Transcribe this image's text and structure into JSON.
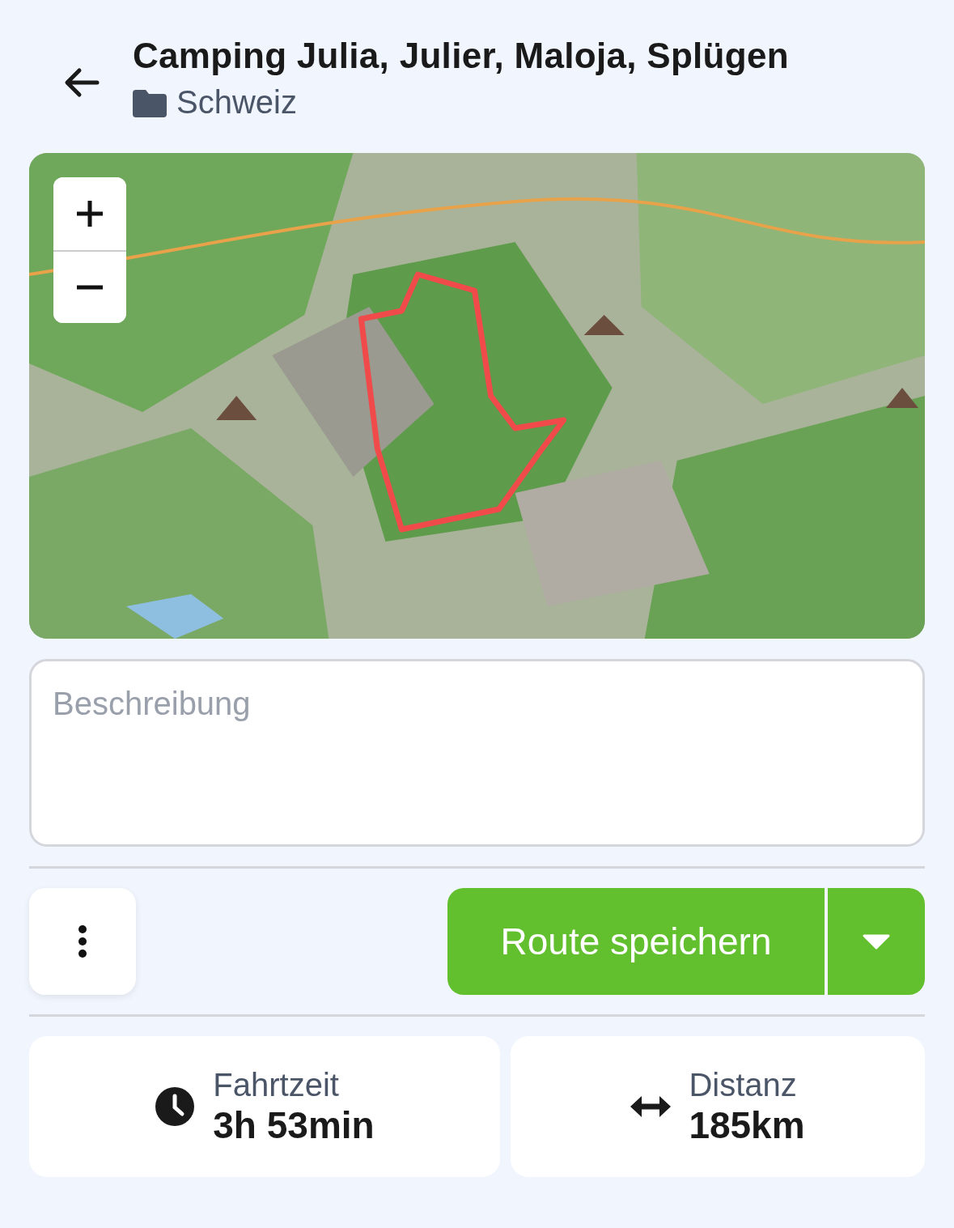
{
  "header": {
    "title": "Camping Julia, Julier, Maloja, Splügen",
    "folder": "Schweiz"
  },
  "description": {
    "placeholder": "Beschreibung"
  },
  "actions": {
    "save_label": "Route speichern"
  },
  "stats": [
    {
      "kind": "time",
      "label": "Fahrtzeit",
      "value": "3h 53min"
    },
    {
      "kind": "distance",
      "label": "Distanz",
      "value": "185km"
    }
  ]
}
